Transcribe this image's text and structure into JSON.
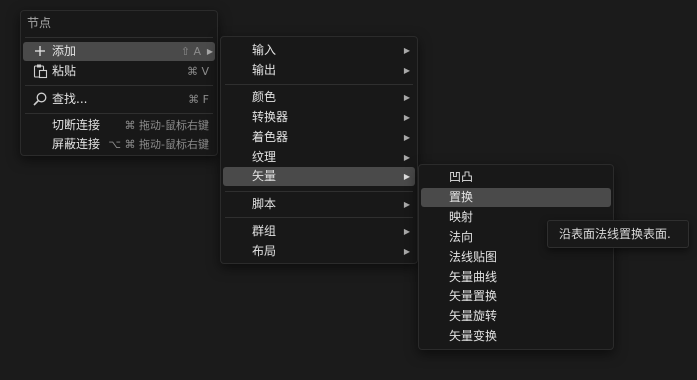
{
  "main_menu": {
    "title": "节点",
    "items": [
      {
        "label": "添加",
        "shortcut": "⇧ A",
        "icon": "plus-icon"
      },
      {
        "label": "粘贴",
        "shortcut": "⌘ V",
        "icon": "paste-icon"
      },
      {
        "label": "查找...",
        "shortcut": "⌘ F",
        "icon": "search-icon"
      },
      {
        "label": "切断连接",
        "shortcut": "⌘ 拖动-鼠标右键"
      },
      {
        "label": "屏蔽连接",
        "shortcut": "⌥ ⌘ 拖动-鼠标右键"
      }
    ]
  },
  "add_menu": {
    "items": [
      {
        "label": "输入"
      },
      {
        "label": "输出"
      },
      {
        "label": "颜色"
      },
      {
        "label": "转换器"
      },
      {
        "label": "着色器"
      },
      {
        "label": "纹理"
      },
      {
        "label": "矢量"
      },
      {
        "label": "脚本"
      },
      {
        "label": "群组"
      },
      {
        "label": "布局"
      }
    ]
  },
  "vector_menu": {
    "items": [
      {
        "label": "凹凸"
      },
      {
        "label": "置换"
      },
      {
        "label": "映射"
      },
      {
        "label": "法向"
      },
      {
        "label": "法线贴图"
      },
      {
        "label": "矢量曲线"
      },
      {
        "label": "矢量置换"
      },
      {
        "label": "矢量旋转"
      },
      {
        "label": "矢量变换"
      }
    ]
  },
  "tooltip": {
    "text": "沿表面法线置换表面."
  },
  "colors": {
    "highlight": "#4a4a4a",
    "background": "#1b1b1b",
    "menu_bg": "#181818"
  }
}
